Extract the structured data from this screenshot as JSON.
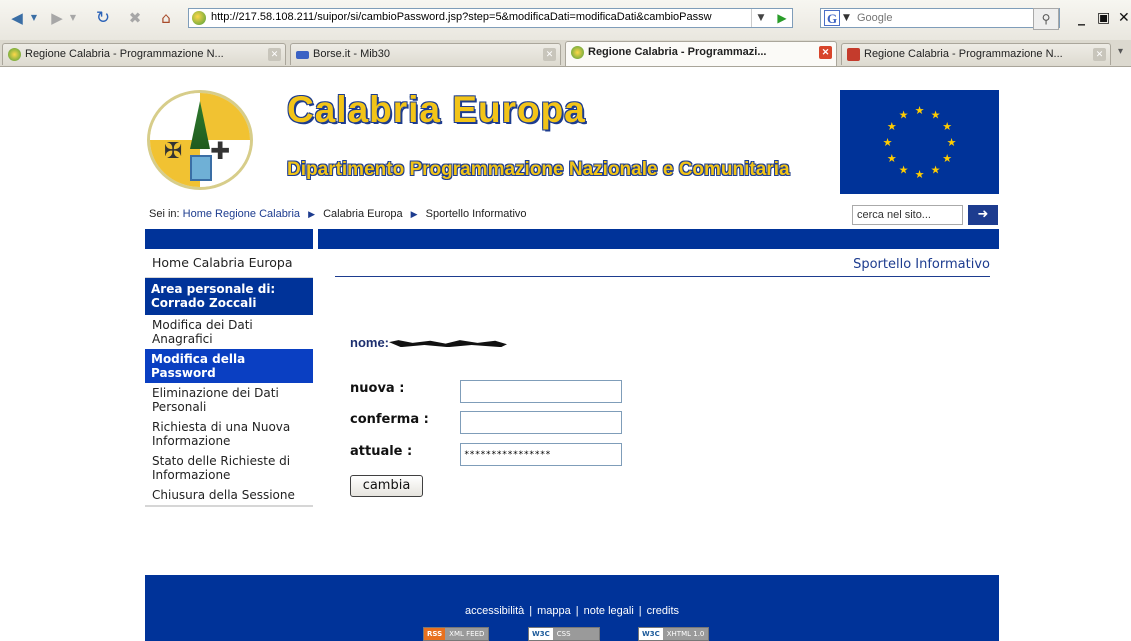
{
  "browser": {
    "url": "http://217.58.108.211/suipor/si/cambioPassword.jsp?step=5&modificaDati=modificaDati&cambioPassw",
    "search_placeholder": "Google",
    "tabs": [
      {
        "label": "Regione Calabria - Programmazione N...",
        "active": false
      },
      {
        "label": "Borse.it - Mib30",
        "active": false
      },
      {
        "label": "Regione Calabria - Programmazi...",
        "active": true
      },
      {
        "label": "Regione Calabria - Programmazione N...",
        "active": false
      }
    ]
  },
  "header": {
    "title": "Calabria Europa",
    "subtitle": "Dipartimento Programmazione Nazionale e Comunitaria"
  },
  "breadcrumb": {
    "prefix": "Sei in:",
    "items": [
      "Home Regione Calabria",
      "Calabria Europa",
      "Sportello Informativo"
    ],
    "search_value": "cerca nel sito..."
  },
  "sidebar": {
    "home": "Home Calabria Europa",
    "area_label": "Area personale di:",
    "user": "Corrado Zoccali",
    "items": [
      {
        "label": "Modifica dei Dati Anagrafici",
        "active": false
      },
      {
        "label": "Modifica della Password",
        "active": true
      },
      {
        "label": "Eliminazione dei Dati Personali",
        "active": false
      },
      {
        "label": "Richiesta di una Nuova Informazione",
        "active": false
      },
      {
        "label": "Stato delle Richieste di Informazione",
        "active": false
      },
      {
        "label": "Chiusura della Sessione",
        "active": false
      }
    ]
  },
  "content": {
    "section_title": "Sportello Informativo",
    "nome_label": "nome:",
    "form": {
      "nuova_label": "nuova :",
      "conferma_label": "conferma :",
      "attuale_label": "attuale :",
      "nuova_value": "",
      "conferma_value": "",
      "attuale_value": "****************",
      "submit_label": "cambia"
    }
  },
  "footer": {
    "links": [
      "accessibilità",
      "mappa",
      "note legali",
      "credits"
    ],
    "badges": [
      {
        "left": "RSS",
        "right": "XML FEED"
      },
      {
        "left": "W3C",
        "right": "CSS"
      },
      {
        "left": "W3C",
        "right": "XHTML 1.0"
      }
    ]
  },
  "colors": {
    "brand_blue": "#003399",
    "gold": "#f2c418",
    "active_item": "#0a3fc2"
  }
}
